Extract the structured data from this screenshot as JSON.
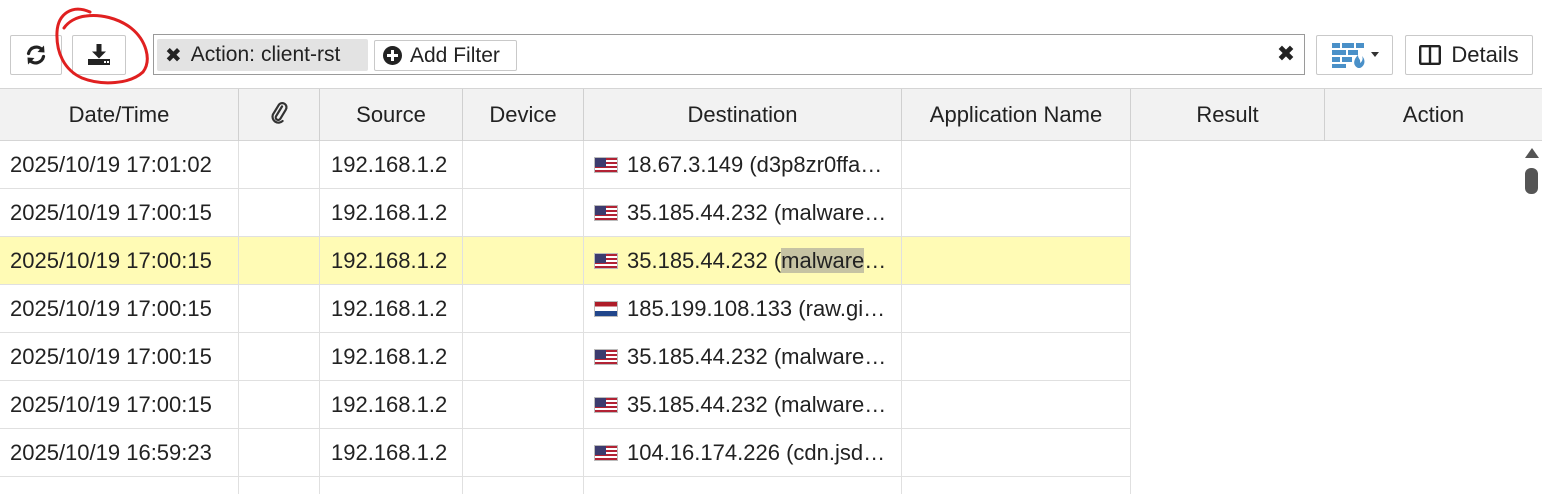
{
  "toolbar": {
    "refresh_icon": "refresh-icon",
    "download_icon": "download-icon",
    "filter_chip": {
      "remove_glyph": "✖",
      "label": "Action:",
      "value": "client-rst"
    },
    "add_filter_label": "Add Filter",
    "clear_glyph": "✖",
    "view_toggle_icon": "firewall-icon",
    "details_label": "Details"
  },
  "table": {
    "columns": [
      "Date/Time",
      "",
      "Source",
      "Device",
      "Destination",
      "Application Name",
      "Result",
      "Action"
    ],
    "attachment_icon": "paperclip-icon",
    "rows": [
      {
        "datetime": "2025/10/19 17:01:02",
        "source": "192.168.1.2",
        "flag": "us",
        "dst_ip": "18.67.3.149",
        "dst_host": "(d3p8zr0ffa…",
        "selected": false
      },
      {
        "datetime": "2025/10/19 17:00:15",
        "source": "192.168.1.2",
        "flag": "us",
        "dst_ip": "35.185.44.232",
        "dst_host": "(malware…",
        "selected": false
      },
      {
        "datetime": "2025/10/19 17:00:15",
        "source": "192.168.1.2",
        "flag": "us",
        "dst_ip": "35.185.44.232",
        "dst_host_pre": "(",
        "dst_host_hl": "malware",
        "dst_host_post": "…",
        "selected": true
      },
      {
        "datetime": "2025/10/19 17:00:15",
        "source": "192.168.1.2",
        "flag": "nl",
        "dst_ip": "185.199.108.133",
        "dst_host": "(raw.gi…",
        "selected": false
      },
      {
        "datetime": "2025/10/19 17:00:15",
        "source": "192.168.1.2",
        "flag": "us",
        "dst_ip": "35.185.44.232",
        "dst_host": "(malware…",
        "selected": false
      },
      {
        "datetime": "2025/10/19 17:00:15",
        "source": "192.168.1.2",
        "flag": "us",
        "dst_ip": "35.185.44.232",
        "dst_host": "(malware…",
        "selected": false
      },
      {
        "datetime": "2025/10/19 16:59:23",
        "source": "192.168.1.2",
        "flag": "us",
        "dst_ip": "104.16.174.226",
        "dst_host": "(cdn.jsd…",
        "selected": false
      }
    ]
  },
  "colors": {
    "selected_row": "#fffbb5",
    "header_bg": "#f2f2f2",
    "annotation": "#e02020",
    "accent_icon": "#4a90c8"
  }
}
